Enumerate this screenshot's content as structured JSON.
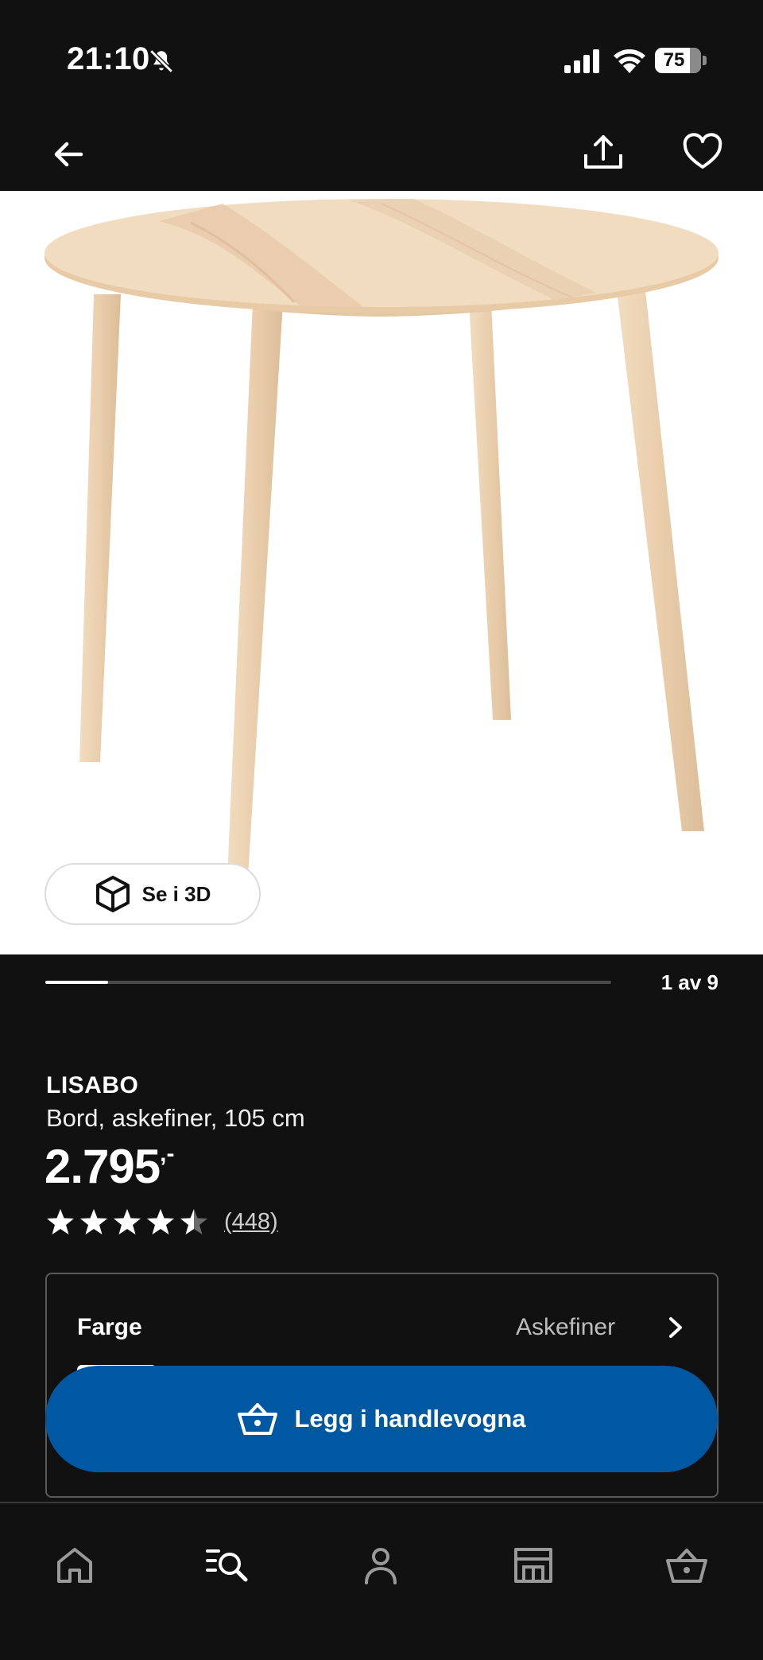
{
  "status_bar": {
    "time": "21:10",
    "battery_level": "75",
    "icons": [
      "bell-off-icon",
      "signal-icon",
      "wifi-icon",
      "battery-icon"
    ]
  },
  "top_nav": {
    "icons": [
      "back-arrow-icon",
      "share-icon",
      "heart-icon"
    ]
  },
  "gallery": {
    "view_3d_label": "Se i 3D",
    "pager_text": "1 av 9",
    "current_image": 1,
    "total_images": 9
  },
  "product": {
    "name": "LISABO",
    "description": "Bord, askefiner, 105 cm",
    "price": "2.795",
    "price_suffix": ",-",
    "rating_value": 4.5,
    "rating_max": 5,
    "review_count": "(448)"
  },
  "options": {
    "color_label": "Farge",
    "color_value": "Askefiner"
  },
  "cta": {
    "label": "Legg i handlevogna",
    "color": "#0058a3"
  },
  "bottom_nav": {
    "items": [
      "home-icon",
      "search-icon",
      "profile-icon",
      "store-icon",
      "cart-icon"
    ]
  }
}
